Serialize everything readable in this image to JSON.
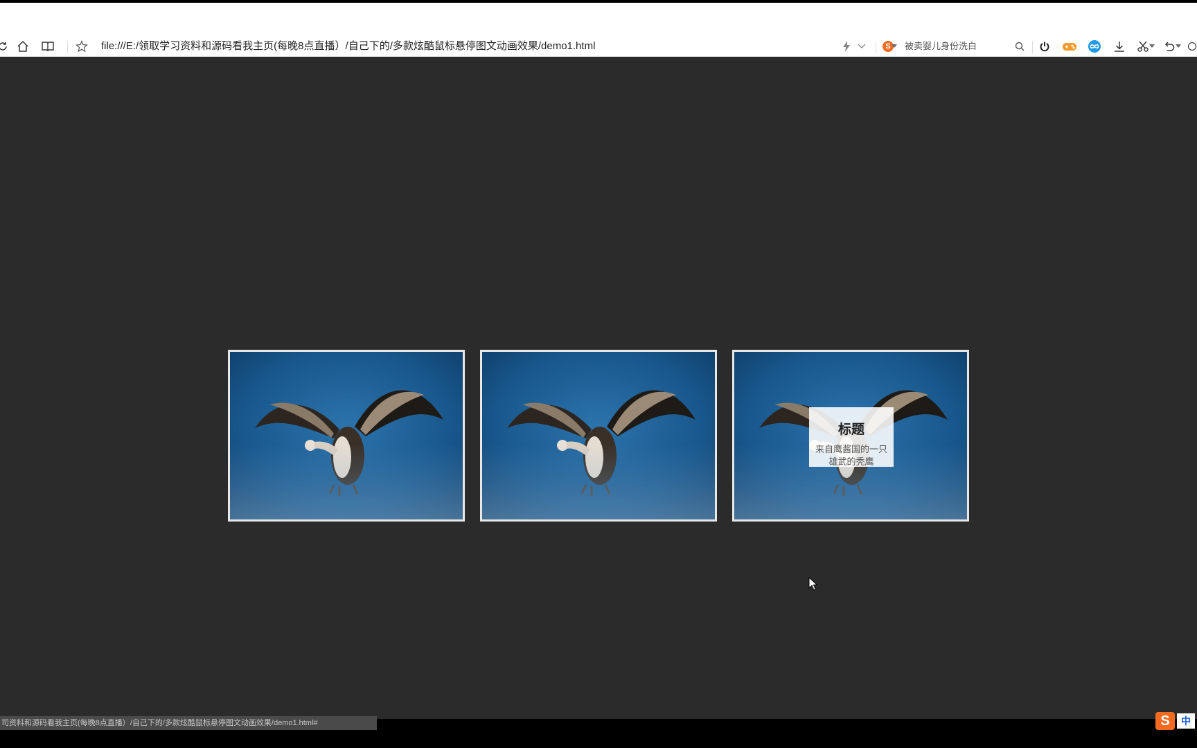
{
  "browser": {
    "url": "file:///E:/领取学习资料和源码看我主页(每晚8点直播）/自己下的/多款炫酷鼠标悬停图文动画效果/demo1.html",
    "search_text": "被卖婴儿身份洗白",
    "status_url": "司资料和源码看我主页(每晚8点直播）/自己下的/多款炫酷鼠标悬停图文动画效果/demo1.html#"
  },
  "icons": {
    "reload": "reload-icon",
    "home": "home-icon",
    "reader": "reader-icon",
    "favorite": "star-icon",
    "lightning": "lightning-icon",
    "search": "search-icon",
    "power": "power-icon",
    "game": "gamepad-icon",
    "link": "infinity-icon",
    "download": "download-icon",
    "scissors": "scissors-icon",
    "undo": "undo-icon"
  },
  "gallery": {
    "cards": [
      {
        "title": "",
        "text": ""
      },
      {
        "title": "",
        "text": ""
      },
      {
        "title": "标题",
        "text": "来自鹰酱国的一只雄武的秃鹰"
      }
    ]
  },
  "ime": {
    "logo": "S",
    "mode": "中"
  },
  "colors": {
    "page_bg": "#2b2b2b",
    "card_border": "#e8e8e8",
    "photo_blue": "#184f7e",
    "sogou_orange": "#f36b21"
  }
}
